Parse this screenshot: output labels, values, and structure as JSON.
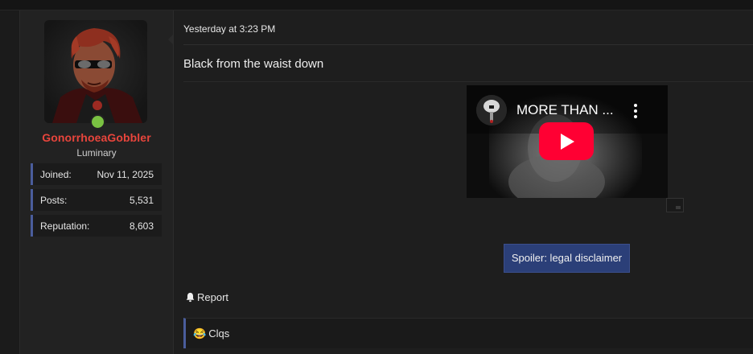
{
  "post": {
    "timestamp": "Yesterday at 3:23 PM",
    "message": "Black from the waist down",
    "video": {
      "title": "MORE THAN ...",
      "channel_icon": "octopus-character-icon",
      "menu_icon": "vertical-dots-icon",
      "play_icon": "youtube-play-icon",
      "play_color": "#ff0033"
    },
    "spoiler_label": "Spoiler: legal disclaimer",
    "report_label": "Report",
    "report_icon": "bell-icon",
    "reaction": {
      "emoji": "😂",
      "label": "Clqs"
    }
  },
  "user": {
    "name": "GonorrhoeaGobbler",
    "title": "Luminary",
    "name_color": "#e8453c",
    "online_color": "#7ac142",
    "stats": [
      {
        "label": "Joined:",
        "value": "Nov 11, 2025"
      },
      {
        "label": "Posts:",
        "value": "5,531"
      },
      {
        "label": "Reputation:",
        "value": "8,603"
      }
    ]
  },
  "theme": {
    "accent": "#4a5d9c",
    "spoiler_bg": "#2b3f78"
  }
}
